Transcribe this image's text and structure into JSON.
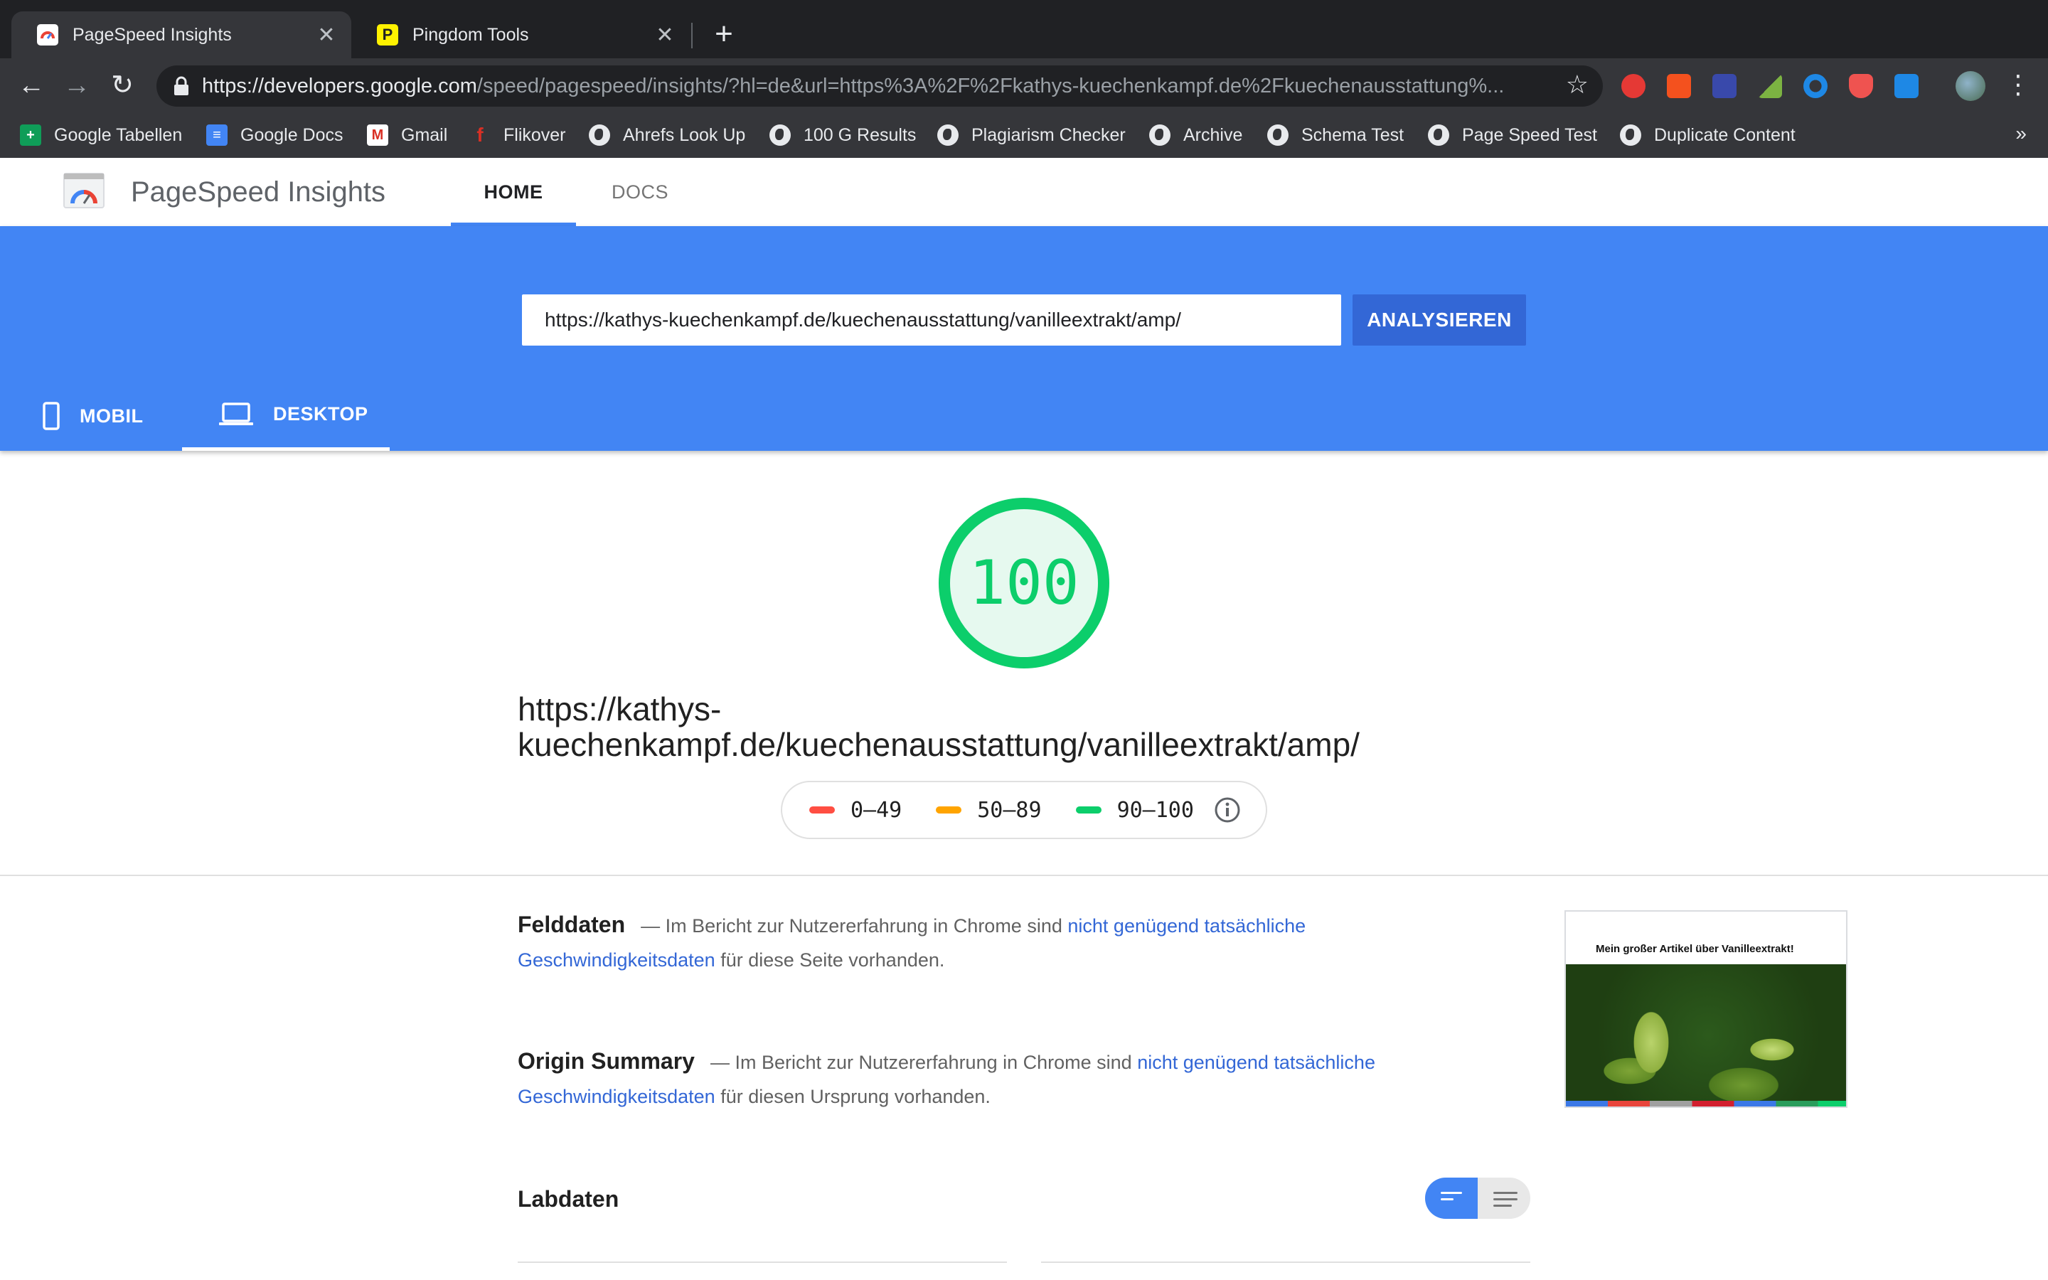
{
  "browser": {
    "tabs": [
      {
        "title": "PageSpeed Insights",
        "active": true,
        "icon": "pagespeed-favicon"
      },
      {
        "title": "Pingdom Tools",
        "active": false,
        "icon": "pingdom-favicon"
      }
    ],
    "close_glyph": "✕",
    "new_tab_glyph": "+",
    "url_host": "https://developers.google.com",
    "url_path": "/speed/pagespeed/insights/?hl=de&url=https%3A%2F%2Fkathys-kuechenkampf.de%2Fkuechenausstattung%...",
    "back_glyph": "←",
    "forward_glyph": "→",
    "reload_glyph": "↻",
    "star_glyph": "☆",
    "menu_glyph": "⋮",
    "extensions": [
      "adblock-icon",
      "extension-red-icon",
      "extension-blue-icon",
      "extension-pen-icon",
      "extension-circle-icon",
      "shield-icon",
      "location-icon"
    ]
  },
  "bookmarks": {
    "items": [
      {
        "label": "Google Tabellen",
        "icon": "sheets-icon"
      },
      {
        "label": "Google Docs",
        "icon": "docs-icon"
      },
      {
        "label": "Gmail",
        "icon": "gmail-icon"
      },
      {
        "label": "Flikover",
        "icon": "flikover-icon"
      },
      {
        "label": "Ahrefs Look Up",
        "icon": "globe-icon"
      },
      {
        "label": "100 G Results",
        "icon": "globe-icon"
      },
      {
        "label": "Plagiarism Checker",
        "icon": "globe-icon"
      },
      {
        "label": "Archive",
        "icon": "globe-icon"
      },
      {
        "label": "Schema Test",
        "icon": "globe-icon"
      },
      {
        "label": "Page Speed Test",
        "icon": "globe-icon"
      },
      {
        "label": "Duplicate Content",
        "icon": "globe-icon"
      }
    ],
    "more_glyph": "»"
  },
  "header": {
    "title": "PageSpeed Insights",
    "nav": {
      "home": "HOME",
      "docs": "DOCS"
    }
  },
  "hero": {
    "url_value": "https://kathys-kuechenkampf.de/kuechenausstattung/vanilleextrakt/amp/",
    "analyze_label": "ANALYSIEREN",
    "tabs": {
      "mobile": "MOBIL",
      "desktop": "DESKTOP"
    },
    "active_tab": "desktop"
  },
  "score": {
    "value": "100",
    "fraction": 1.0,
    "tested_url": "https://kathys-kuechenkampf.de/kuechenausstattung/vanilleextrakt/amp/",
    "tested_url_line1": "https://kathys-",
    "tested_url_line2": "kuechenkampf.de/kuechenausstattung/vanilleextrakt/amp/",
    "legend": [
      {
        "range": "0–49",
        "color": "#ff4e42"
      },
      {
        "range": "50–89",
        "color": "#ffa400"
      },
      {
        "range": "90–100",
        "color": "#0cce6b"
      }
    ]
  },
  "field_data": {
    "title": "Felddaten",
    "dash": "—",
    "text_before": "Im Bericht zur Nutzererfahrung in Chrome sind",
    "link": "nicht genügend tatsächliche Geschwindigkeitsdaten",
    "text_after": "für diese Seite vorhanden."
  },
  "origin_summary": {
    "title": "Origin Summary",
    "dash": "—",
    "text_before": "Im Bericht zur Nutzererfahrung in Chrome sind",
    "link": "nicht genügend tatsächliche Geschwindigkeitsdaten",
    "text_after": "für diesen Ursprung vorhanden."
  },
  "screenshot": {
    "headline": "Mein großer Artikel über Vanilleextrakt!"
  },
  "lab": {
    "title": "Labdaten"
  },
  "colors": {
    "brand_blue": "#4285f4",
    "button_blue": "#3367d6",
    "score_green": "#0cce6b",
    "link_blue": "#3367d6"
  }
}
